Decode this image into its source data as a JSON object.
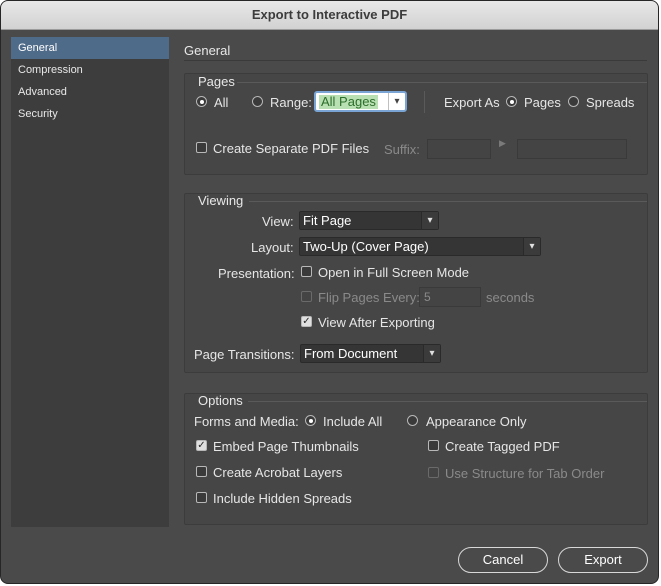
{
  "window": {
    "title": "Export to Interactive PDF"
  },
  "sidebar": {
    "items": [
      {
        "label": "General",
        "selected": true
      },
      {
        "label": "Compression"
      },
      {
        "label": "Advanced"
      },
      {
        "label": "Security"
      }
    ]
  },
  "main": {
    "title": "General"
  },
  "pages": {
    "title": "Pages",
    "all_label": "All",
    "range_label": "Range:",
    "range_value": "All Pages",
    "export_as_label": "Export As",
    "pages_label": "Pages",
    "spreads_label": "Spreads",
    "separate_files_label": "Create Separate PDF Files",
    "suffix_label": "Suffix:"
  },
  "viewing": {
    "title": "Viewing",
    "view_label": "View:",
    "view_value": "Fit Page",
    "layout_label": "Layout:",
    "layout_value": "Two-Up (Cover Page)",
    "presentation_label": "Presentation:",
    "full_screen_label": "Open in Full Screen Mode",
    "flip_pages_label": "Flip Pages Every:",
    "flip_value": "5",
    "seconds_label": "seconds",
    "view_after_label": "View After Exporting",
    "transitions_label": "Page Transitions:",
    "transitions_value": "From Document"
  },
  "options": {
    "title": "Options",
    "forms_label": "Forms and Media:",
    "include_all_label": "Include All",
    "appearance_only_label": "Appearance Only",
    "embed_thumbnails_label": "Embed Page Thumbnails",
    "tagged_pdf_label": "Create Tagged PDF",
    "acrobat_layers_label": "Create Acrobat Layers",
    "tab_order_label": "Use Structure for Tab Order",
    "hidden_spreads_label": "Include Hidden Spreads"
  },
  "buttons": {
    "cancel": "Cancel",
    "export": "Export"
  },
  "colors": {
    "accent": "#4f6b8a",
    "dialog_bg": "#4a4a4a",
    "range_highlight": "#b9e0b2"
  },
  "icons": {
    "dropdown": "chevron-down-icon",
    "checkmark": "checkmark-icon",
    "arrow": "triangle-right-icon"
  }
}
